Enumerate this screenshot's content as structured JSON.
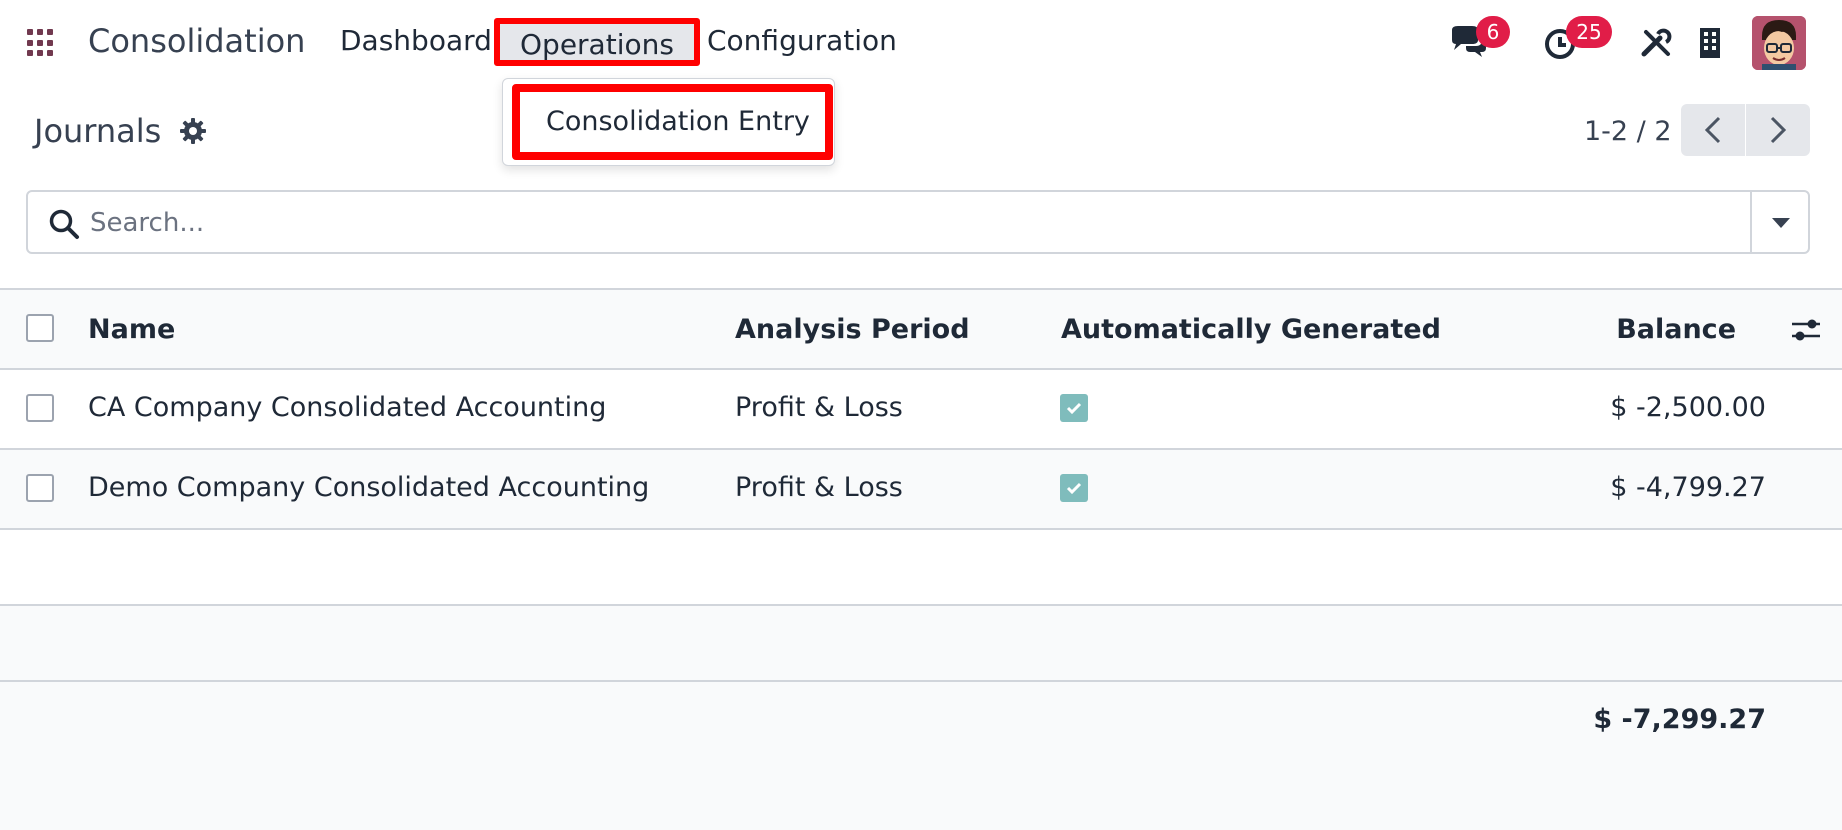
{
  "navbar": {
    "app_name": "Consolidation",
    "menus": [
      "Dashboard",
      "Operations",
      "Configuration"
    ],
    "dropdown_item": "Consolidation Entry",
    "messages_count": "6",
    "activities_count": "25",
    "accent_color": "#71394f",
    "highlight_color": "#ff0000"
  },
  "control_panel": {
    "title": "Journals",
    "pager": "1-2 / 2"
  },
  "search": {
    "placeholder": "Search..."
  },
  "table": {
    "columns": [
      "Name",
      "Analysis Period",
      "Automatically Generated",
      "Balance"
    ],
    "rows": [
      {
        "name": "CA Company Consolidated Accounting",
        "period": "Profit & Loss",
        "auto": true,
        "balance": "$ -2,500.00"
      },
      {
        "name": "Demo Company Consolidated Accounting",
        "period": "Profit & Loss",
        "auto": true,
        "balance": "$ -4,799.27"
      }
    ],
    "total": "$ -7,299.27"
  }
}
